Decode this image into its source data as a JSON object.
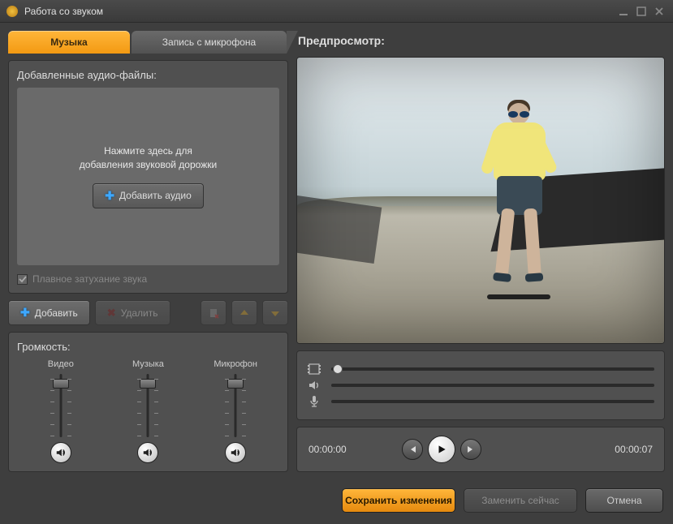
{
  "window": {
    "title": "Работа со звуком"
  },
  "tabs": {
    "music": "Музыка",
    "mic": "Запись с микрофона"
  },
  "addedFiles": {
    "heading": "Добавленные аудио-файлы:",
    "hint_line1": "Нажмите здесь для",
    "hint_line2": "добавления звуковой дорожки",
    "add_audio_btn": "Добавить аудио",
    "fade_label": "Плавное затухание звука",
    "fade_checked": true
  },
  "toolbar": {
    "add": "Добавить",
    "delete": "Удалить"
  },
  "volume": {
    "heading": "Громкость:",
    "video": "Видео",
    "music": "Музыка",
    "mic": "Микрофон",
    "levels": {
      "video": 85,
      "music": 85,
      "mic": 85
    }
  },
  "preview": {
    "label": "Предпросмотр:"
  },
  "playback": {
    "position": "00:00:00",
    "duration": "00:00:07",
    "slider_position_pct": 2
  },
  "footer": {
    "save": "Сохранить изменения",
    "replace": "Заменить сейчас",
    "cancel": "Отмена"
  },
  "colors": {
    "accent": "#f39a12",
    "panel": "#505050",
    "bg": "#3e3e3e"
  }
}
